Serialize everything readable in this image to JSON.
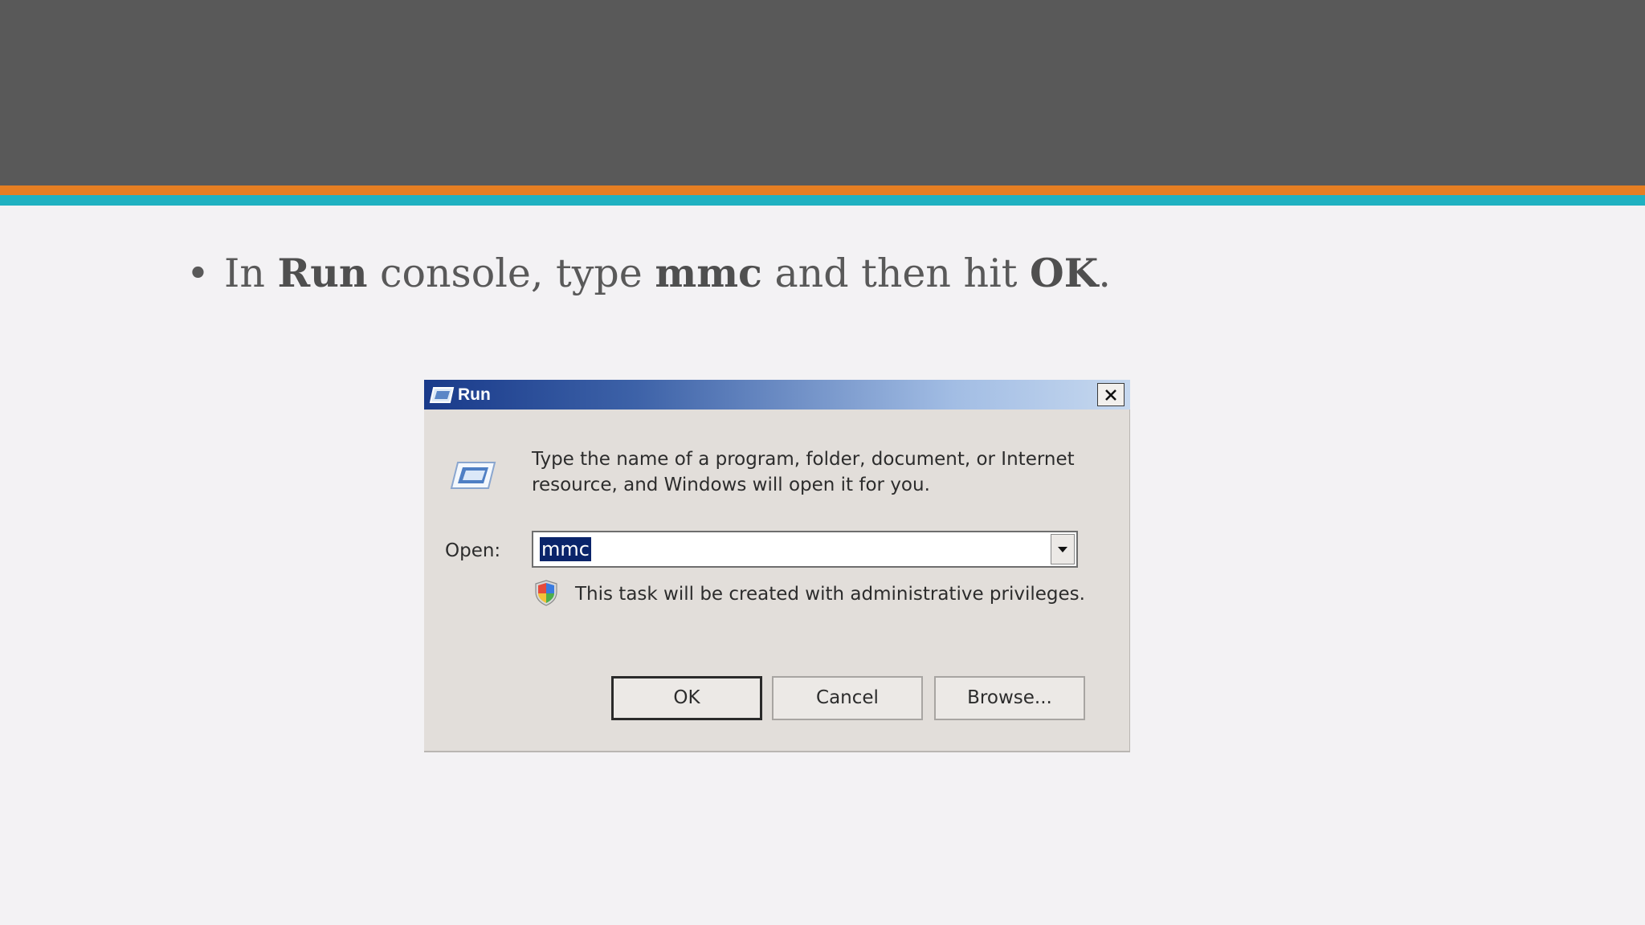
{
  "slide": {
    "bullet": "•",
    "instruction": {
      "t1": "In ",
      "b1": "Run",
      "t2": " console, type ",
      "b2": "mmc",
      "t3": " and then hit ",
      "b3": "OK",
      "t4": "."
    },
    "colors": {
      "header": "#595959",
      "stripe_orange": "#e67e22",
      "stripe_teal": "#1fb1c1",
      "background": "#f3f2f4"
    }
  },
  "run_dialog": {
    "title": "Run",
    "title_icon": "run-program-icon",
    "close_icon": "close-icon",
    "description": "Type the name of a program, folder, document, or Internet resource, and Windows will open it for you.",
    "open_label": "Open:",
    "open_value": "mmc",
    "admin_note": "This task will be created with administrative privileges.",
    "shield_icon": "uac-shield-icon",
    "buttons": {
      "ok": "OK",
      "cancel": "Cancel",
      "browse": "Browse..."
    }
  }
}
